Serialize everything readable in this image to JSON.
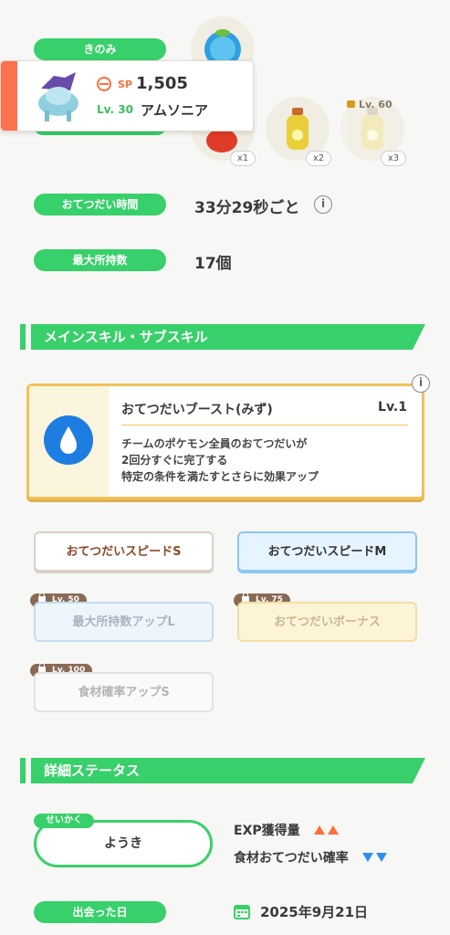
{
  "top": {
    "berry_label": "きのみ",
    "ingredient_qty": [
      "x1",
      "x2",
      "x3"
    ],
    "ingredient_lock_label": "Lv. 60"
  },
  "pokemon_card": {
    "sp_label": "SP",
    "sp_value": "1,505",
    "level": "Lv. 30",
    "name": "アムソニア"
  },
  "stats": {
    "help_time_label": "おてつだい時間",
    "help_time_value": "33分29秒ごと",
    "capacity_label": "最大所持数",
    "capacity_value": "17個"
  },
  "skills_section": {
    "title": "メインスキル・サブスキル",
    "main_skill": {
      "name": "おてつだいブースト(みず)",
      "level": "Lv.1",
      "desc_line1": "チームのポケモン全員のおてつだいが",
      "desc_line2": "2回分すぐに完了する",
      "desc_line3": "特定の条件を満たすとさらに効果アップ"
    },
    "sub_skills": [
      {
        "label": "おてつだいスピードS",
        "lock": ""
      },
      {
        "label": "おてつだいスピードM",
        "lock": ""
      },
      {
        "label": "最大所持数アップL",
        "lock": "Lv. 50"
      },
      {
        "label": "おてつだいボーナス",
        "lock": "Lv. 75"
      },
      {
        "label": "食材確率アップS",
        "lock": "Lv. 100"
      }
    ]
  },
  "detail_section": {
    "title": "詳細ステータス",
    "nature_tag": "せいかく",
    "nature_value": "ようき",
    "up_stat": "EXP獲得量",
    "down_stat": "食材おてつだい確率",
    "met_label": "出会った日",
    "met_date": "2025年9月21日"
  },
  "colors": {
    "accent_green": "#38d06a",
    "card_accent": "#ff7150",
    "main_skill_border": "#f1c25a",
    "water_blue": "#2f8fe8"
  }
}
